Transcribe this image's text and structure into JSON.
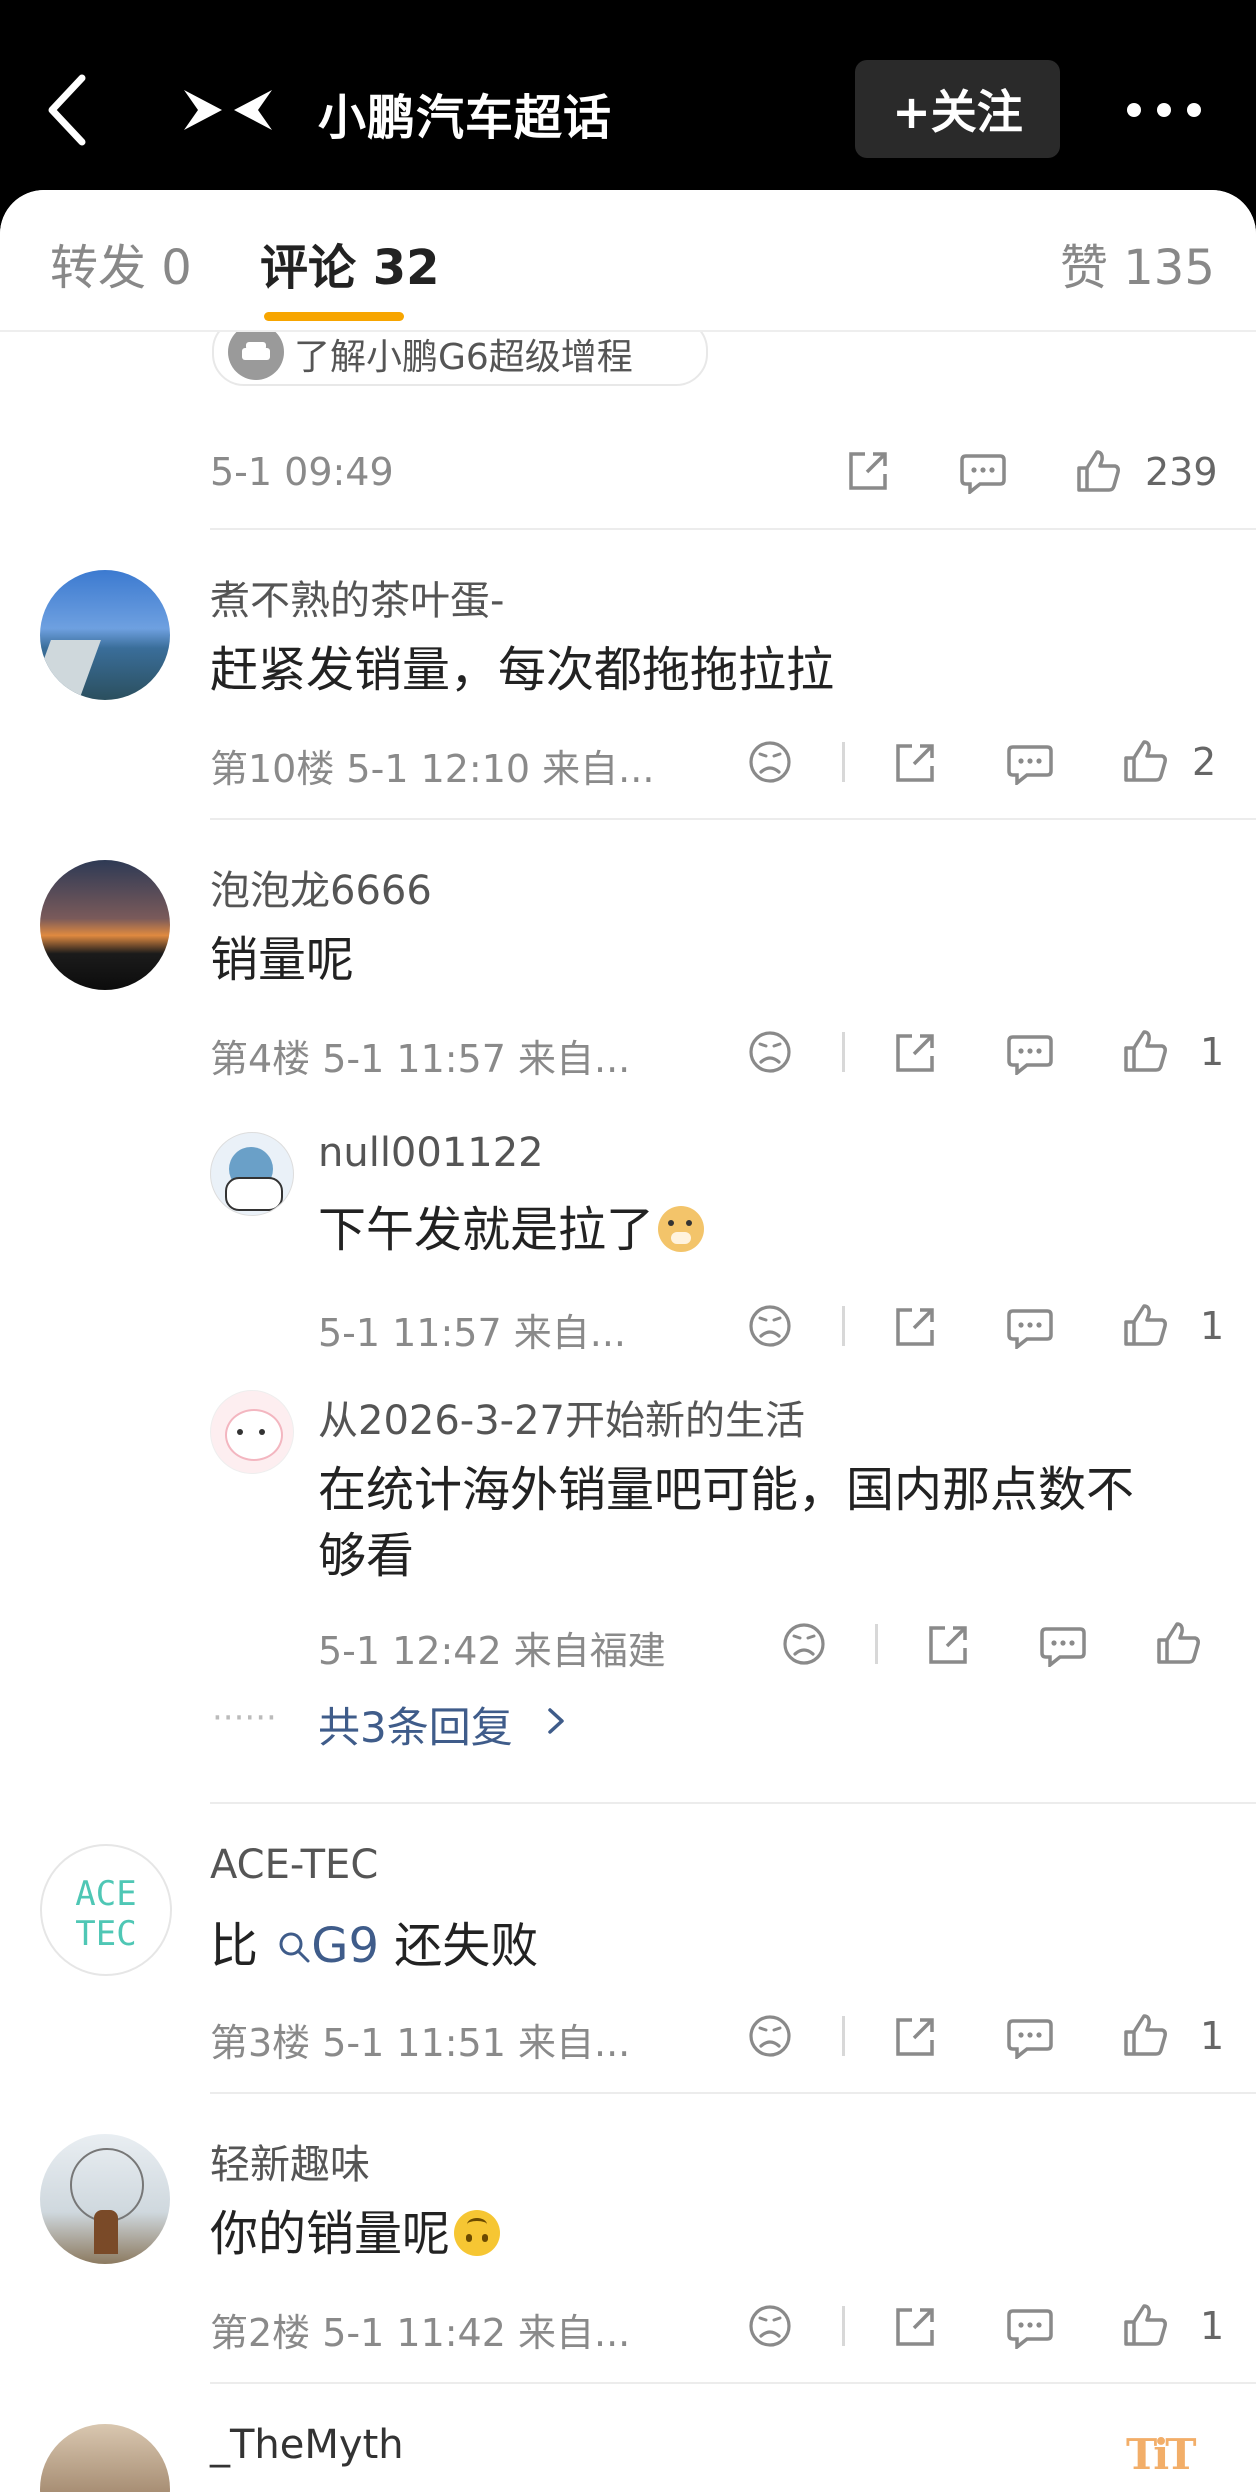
{
  "header": {
    "title": "小鹏汽车超话",
    "follow_label": "+关注"
  },
  "tabs": {
    "repost": "转发 0",
    "comment": "评论 32",
    "like": "赞 135"
  },
  "post_footer": {
    "chip_text": "了解小鹏G6超级增程",
    "time": "5-1 09:49",
    "like_count": "239"
  },
  "comments": [
    {
      "name": "煮不熟的茶叶蛋-",
      "text": "赶紧发销量，每次都拖拖拉拉",
      "meta": "第10楼 5-1 12:10 来自...",
      "likes": "2"
    },
    {
      "name": "泡泡龙6666",
      "text": "销量呢",
      "meta": "第4楼 5-1 11:57 来自...",
      "likes": "1"
    },
    {
      "name": "ACE-TEC",
      "text_before": "比",
      "link": "G9",
      "text_after": "还失败",
      "meta": "第3楼 5-1 11:51 来自...",
      "likes": "1",
      "avatar_text": "ACE TEC"
    },
    {
      "name": "轻新趣味",
      "text": "你的销量呢",
      "meta": "第2楼 5-1 11:42 来自...",
      "likes": "1"
    },
    {
      "name": "_TheMyth"
    }
  ],
  "replies": [
    {
      "name": "null001122",
      "text": "下午发就是拉了",
      "meta": "5-1 11:57 来自...",
      "likes": "1"
    },
    {
      "name": "从2026-3-27开始新的生活",
      "text_line1": "在统计海外销量吧可能，国内那点数不",
      "text_line2": "够看",
      "meta": "5-1 12:42 来自福建"
    }
  ],
  "more_replies": "共3条回复",
  "colors": {
    "accent": "#f7a500",
    "link": "#3f5c8a"
  }
}
